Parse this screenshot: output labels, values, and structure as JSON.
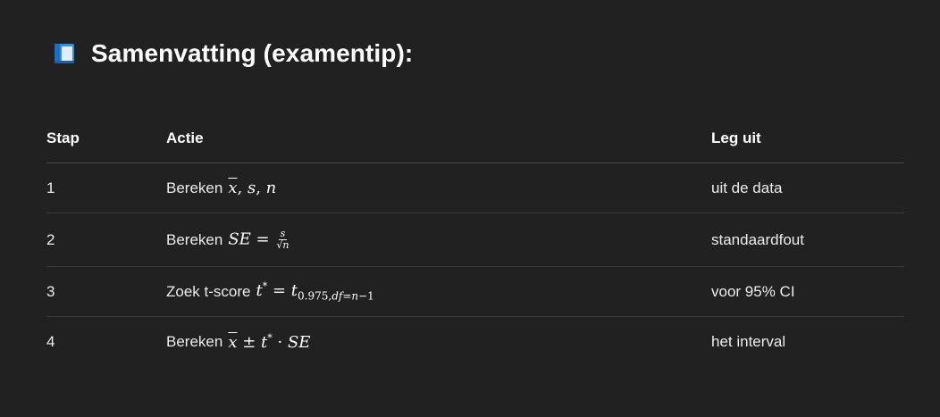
{
  "heading": {
    "icon": "blue-book-icon",
    "title": "Samenvatting (examentip):"
  },
  "table": {
    "headers": {
      "step": "Stap",
      "action": "Actie",
      "explain": "Leg uit"
    },
    "rows": [
      {
        "step": "1",
        "action_text": "Bereken",
        "explain": "uit de data"
      },
      {
        "step": "2",
        "action_text": "Bereken",
        "explain": "standaardfout"
      },
      {
        "step": "3",
        "action_text": "Zoek t-score",
        "explain": "voor 95% CI"
      },
      {
        "step": "4",
        "action_text": "Bereken",
        "explain": "het interval"
      }
    ]
  },
  "colors": {
    "background": "#212121",
    "text": "#ececec",
    "divider": "#3a3a3a",
    "book_blue": "#2f8de4"
  }
}
